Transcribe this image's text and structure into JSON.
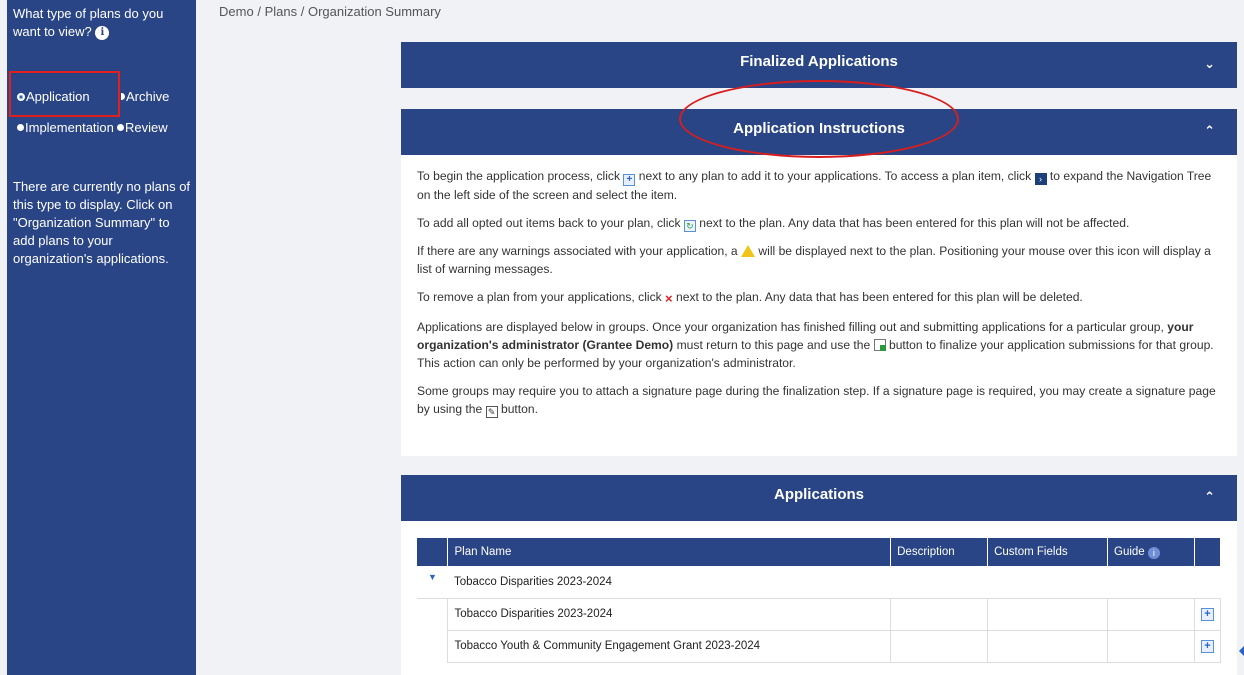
{
  "sidebar": {
    "question": "What type of plans do you want to view?",
    "info_icon": "info-icon",
    "options": {
      "application": "Application",
      "archive": "Archive",
      "implementation": "Implementation",
      "review": "Review"
    },
    "selected": "Application",
    "empty_message": "There are currently no plans of this type to display. Click on \"Organization Summary\" to add plans to your organization's applications."
  },
  "breadcrumb": {
    "items": [
      "Demo",
      "Plans",
      "Organization Summary"
    ],
    "separator": "/"
  },
  "panels": {
    "finalized": {
      "title": "Finalized Applications",
      "chevron": "⌄"
    },
    "instructions": {
      "title": "Application Instructions",
      "chevron": "⌃"
    },
    "applications": {
      "title": "Applications",
      "chevron": "⌃"
    }
  },
  "instructions": {
    "p1a": "To begin the application process, click",
    "p1b": "next to any plan to add it to your applications. To access a plan item, click",
    "p1c": "to expand the Navigation Tree on the left side of the screen and select the item.",
    "p2a": "To add all opted out items back to your plan, click",
    "p2b": "next to the plan. Any data that has been entered for this plan will not be affected.",
    "p3a": "If there are any warnings associated with your application, a",
    "p3b": "will be displayed next to the plan. Positioning your mouse over this icon will display a list of warning messages.",
    "p4a": "To remove a plan from your applications, click",
    "p4b": "next to the plan. Any data that has been entered for this plan will be deleted.",
    "p5a": "Applications are displayed below in groups. Once your organization has finished filling out and submitting applications for a particular group,",
    "p5bold": "your organization's administrator (Grantee Demo)",
    "p5b": "must return to this page and use the",
    "p5c": "button to finalize your application submissions for that group. This action can only be performed by your organization's administrator.",
    "p6a": "Some groups may require you to attach a signature page during the finalization step. If a signature page is required, you may create a signature page by using the",
    "p6b": "button."
  },
  "table": {
    "headers": {
      "plan_name": "Plan Name",
      "description": "Description",
      "custom_fields": "Custom Fields",
      "guide": "Guide"
    },
    "group": "Tobacco Disparities 2023-2024",
    "rows": [
      {
        "name": "Tobacco Disparities 2023-2024"
      },
      {
        "name": "Tobacco Youth & Community Engagement Grant 2023-2024"
      }
    ]
  },
  "colors": {
    "sidebar": "#2a4585",
    "panel_header": "#2a4585",
    "annotation": "#d71e1e"
  }
}
